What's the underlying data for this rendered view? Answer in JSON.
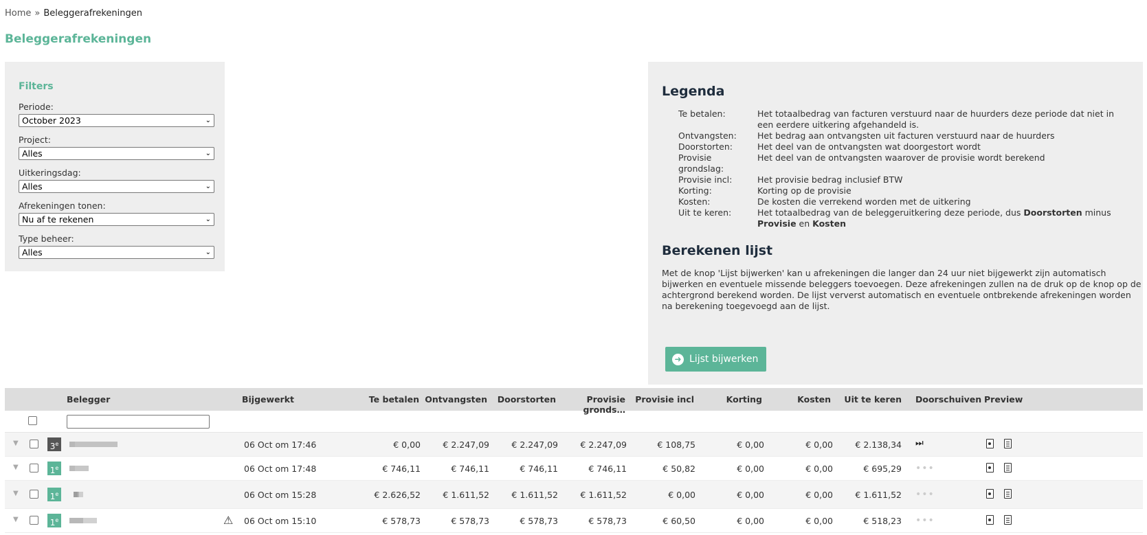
{
  "breadcrumb": {
    "home": "Home",
    "sep": "»",
    "current": "Beleggerafrekeningen"
  },
  "page_title": "Beleggerafrekeningen",
  "filters": {
    "title": "Filters",
    "fields": [
      {
        "label": "Periode:",
        "value": "October 2023"
      },
      {
        "label": "Project:",
        "value": "Alles"
      },
      {
        "label": "Uitkeringsdag:",
        "value": "Alles"
      },
      {
        "label": "Afrekeningen tonen:",
        "value": "Nu af te rekenen"
      },
      {
        "label": "Type beheer:",
        "value": "Alles"
      }
    ]
  },
  "legend": {
    "title": "Legenda",
    "items": [
      {
        "term": "Te betalen:",
        "desc": "Het totaalbedrag van facturen verstuurd naar de huurders deze periode dat niet in een eerdere uitkering afgehandeld is."
      },
      {
        "term": "Ontvangsten:",
        "desc": "Het bedrag aan ontvangsten uit facturen verstuurd naar de huurders"
      },
      {
        "term": "Doorstorten:",
        "desc": "Het deel van de ontvangsten wat doorgestort wordt"
      },
      {
        "term": "Provisie grondslag:",
        "desc": "Het deel van de ontvangsten waarover de provisie wordt berekend"
      },
      {
        "term": "Provisie incl:",
        "desc": "Het provisie bedrag inclusief BTW"
      },
      {
        "term": "Korting:",
        "desc": "Korting op de provisie"
      },
      {
        "term": "Kosten:",
        "desc": "De kosten die verrekend worden met de uitkering"
      },
      {
        "term": "Uit te keren:",
        "desc_a": "Het totaalbedrag van de beleggeruitkering deze periode, dus ",
        "desc_b": "Doorstorten",
        "desc_c": " minus ",
        "desc_d": "Provisie",
        "desc_e": " en ",
        "desc_f": "Kosten"
      }
    ],
    "calc_title": "Berekenen lijst",
    "calc_text": "Met de knop 'Lijst bijwerken' kan u afrekeningen die langer dan 24 uur niet bijgewerkt zijn automatisch bijwerken en eventuele missende beleggers toevoegen. Deze afrekeningen zullen na de druk op de knop op de achtergrond berekend worden. De lijst ververst automatisch en eventuele ontbrekende afrekeningen worden na berekening toegevoegd aan de lijst.",
    "button": "Lijst bijwerken"
  },
  "table": {
    "headers": {
      "belegger": "Belegger",
      "bijgewerkt": "Bijgewerkt",
      "te_betalen": "Te betalen",
      "ontvangsten": "Ontvangsten",
      "doorstorten": "Doorstorten",
      "provisie_grondslag": "Provisie gronds…",
      "provisie_incl": "Provisie incl",
      "korting": "Korting",
      "kosten": "Kosten",
      "uit_te_keren": "Uit te keren",
      "doorschuiven": "Doorschuiven",
      "preview": "Preview"
    },
    "rows": [
      {
        "badge": "3",
        "badge_sup": "e",
        "badge_color": "#555555",
        "bijgewerkt": "06 Oct om 17:46",
        "te_betalen": "€ 0,00",
        "ontvangsten": "€ 2.247,09",
        "doorstorten": "€ 2.247,09",
        "provisie_grondslag": "€ 2.247,09",
        "provisie_incl": "€ 108,75",
        "korting": "€ 0,00",
        "kosten": "€ 0,00",
        "uit_te_keren": "€ 2.138,34",
        "doorschuiven": "⏭"
      },
      {
        "badge": "1",
        "badge_sup": "e",
        "badge_color": "#5cb598",
        "bijgewerkt": "06 Oct om 17:48",
        "te_betalen": "€ 746,11",
        "ontvangsten": "€ 746,11",
        "doorstorten": "€ 746,11",
        "provisie_grondslag": "€ 746,11",
        "provisie_incl": "€ 50,82",
        "korting": "€ 0,00",
        "kosten": "€ 0,00",
        "uit_te_keren": "€ 695,29",
        "doorschuiven": "•••"
      },
      {
        "badge": "1",
        "badge_sup": "e",
        "badge_color": "#5cb598",
        "bijgewerkt": "06 Oct om 15:28",
        "te_betalen": "€ 2.626,52",
        "ontvangsten": "€ 1.611,52",
        "doorstorten": "€ 1.611,52",
        "provisie_grondslag": "€ 1.611,52",
        "provisie_incl": "€ 0,00",
        "korting": "€ 0,00",
        "kosten": "€ 0,00",
        "uit_te_keren": "€ 1.611,52",
        "doorschuiven": "•••"
      },
      {
        "badge": "1",
        "badge_sup": "e",
        "badge_color": "#5cb598",
        "bijgewerkt": "06 Oct om 15:10",
        "te_betalen": "€ 578,73",
        "ontvangsten": "€ 578,73",
        "doorstorten": "€ 578,73",
        "provisie_grondslag": "€ 578,73",
        "provisie_incl": "€ 60,50",
        "korting": "€ 0,00",
        "kosten": "€ 0,00",
        "uit_te_keren": "€ 518,23",
        "doorschuiven": "•••"
      }
    ]
  },
  "colors": {
    "accent": "#5cb598",
    "panel": "#eeeeee",
    "header": "#dddddd"
  }
}
